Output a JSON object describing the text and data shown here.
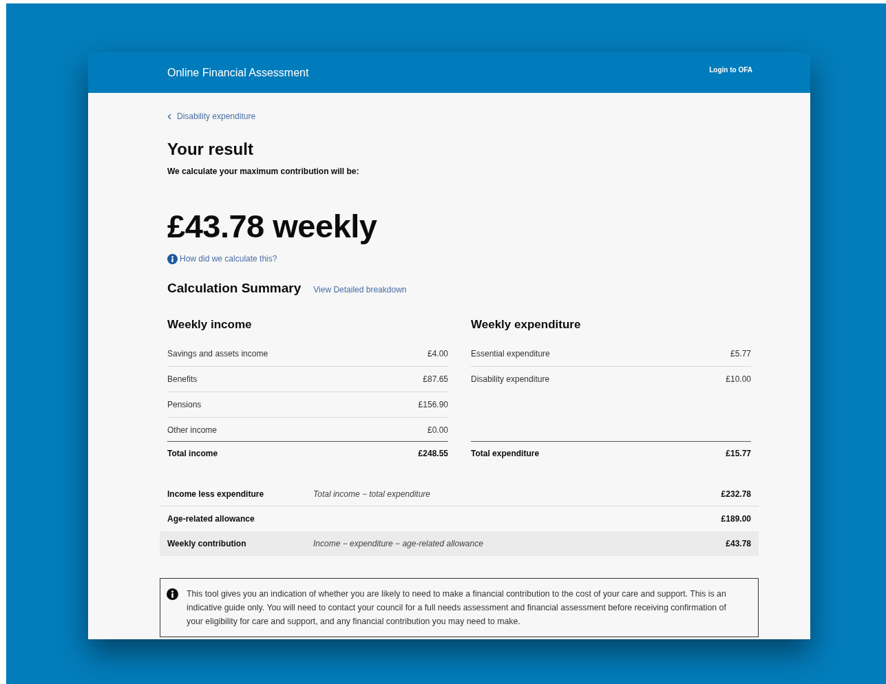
{
  "header": {
    "title": "Online Financial Assessment",
    "login_link": "Login to OFA"
  },
  "back_link": "Disability expenditure",
  "heading": "Your result",
  "intro": "We calculate your maximum contribution will be:",
  "amount": "£43.78 weekly",
  "help_link": "How did we calculate this?",
  "summary": {
    "title": "Calculation Summary",
    "breakdown_link": "View Detailed breakdown"
  },
  "income": {
    "title": "Weekly income",
    "rows": [
      {
        "label": "Savings and assets income",
        "value": "£4.00"
      },
      {
        "label": "Benefits",
        "value": "£87.65"
      },
      {
        "label": "Pensions",
        "value": "£156.90"
      },
      {
        "label": "Other income",
        "value": "£0.00"
      }
    ],
    "total": {
      "label": "Total income",
      "value": "£248.55"
    }
  },
  "expenditure": {
    "title": "Weekly expenditure",
    "rows": [
      {
        "label": "Essential expenditure",
        "value": "£5.77"
      },
      {
        "label": "Disability expenditure",
        "value": "£10.00"
      }
    ],
    "total": {
      "label": "Total expenditure",
      "value": "£15.77"
    }
  },
  "calculation_rows": [
    {
      "label": "Income less expenditure",
      "formula": "Total income − total expenditure",
      "value": "£232.78",
      "highlighted": false
    },
    {
      "label": "Age-related allowance",
      "value": "£189.00",
      "highlighted": false
    },
    {
      "label": "Weekly contribution",
      "formula": "Income − expenditure − age-related allowance",
      "value": "£43.78",
      "highlighted": true
    }
  ],
  "notice": "This tool gives you an indication of whether you are likely to need to make a financial contribution to the cost of your care and support. This is an indicative guide only. You will need to contact your council for a full needs assessment and financial assessment before receiving confirmation of your eligibility for care and support, and any financial contribution you may need to make."
}
